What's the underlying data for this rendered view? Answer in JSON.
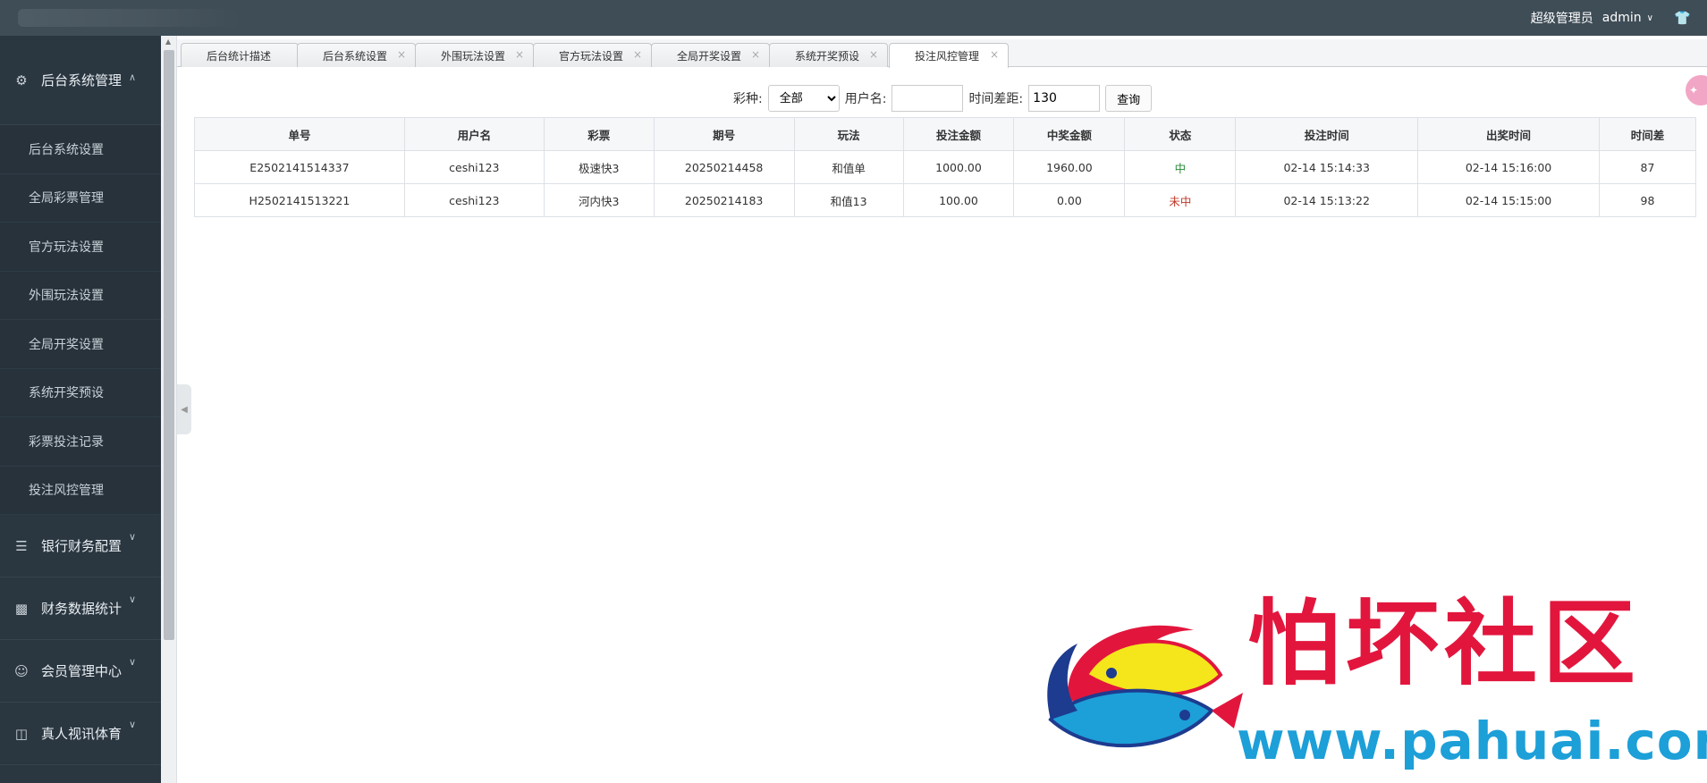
{
  "header": {
    "role": "超级管理员",
    "username": "admin"
  },
  "sidebar": {
    "groups": [
      {
        "label": "后台系统管理",
        "icon": "gear-icon"
      },
      {
        "label": "银行财务配置",
        "icon": "list-icon"
      },
      {
        "label": "财务数据统计",
        "icon": "bar-chart-icon"
      },
      {
        "label": "会员管理中心",
        "icon": "user-icon"
      },
      {
        "label": "真人视讯体育",
        "icon": "gift-icon"
      }
    ],
    "items": [
      "后台系统设置",
      "全局彩票管理",
      "官方玩法设置",
      "外围玩法设置",
      "全局开奖设置",
      "系统开奖预设",
      "彩票投注记录",
      "投注风控管理"
    ]
  },
  "tabs": [
    {
      "label": "后台统计描述"
    },
    {
      "label": "后台系统设置"
    },
    {
      "label": "外围玩法设置"
    },
    {
      "label": "官方玩法设置"
    },
    {
      "label": "全局开奖设置"
    },
    {
      "label": "系统开奖预设"
    },
    {
      "label": "投注风控管理"
    }
  ],
  "filters": {
    "lottery_label": "彩种:",
    "lottery_selected": "全部",
    "username_label": "用户名:",
    "username_value": "",
    "time_label": "时间差距:",
    "time_value": "130",
    "query_button": "查询"
  },
  "table": {
    "headers": [
      "单号",
      "用户名",
      "彩票",
      "期号",
      "玩法",
      "投注金额",
      "中奖金额",
      "状态",
      "投注时间",
      "出奖时间",
      "时间差"
    ],
    "rows": [
      [
        "E2502141514337",
        "ceshi123",
        "极速快3",
        "20250214458",
        "和值单",
        "1000.00",
        "1960.00",
        "中",
        "02-14 15:14:33",
        "02-14 15:16:00",
        "87"
      ],
      [
        "H2502141513221",
        "ceshi123",
        "河内快3",
        "20250214183",
        "和值13",
        "100.00",
        "0.00",
        "未中",
        "02-14 15:13:22",
        "02-14 15:15:00",
        "98"
      ]
    ]
  },
  "watermark": {
    "text": "怕坏社区",
    "url": "www.pahuai.com"
  },
  "colors": {
    "topbar": "#3f4d57",
    "sidebar": "#2a3640",
    "status_win": "#2a8a3a",
    "status_lose": "#c0392b",
    "watermark_red": "#e2163d",
    "watermark_blue": "#1d9fd8"
  }
}
